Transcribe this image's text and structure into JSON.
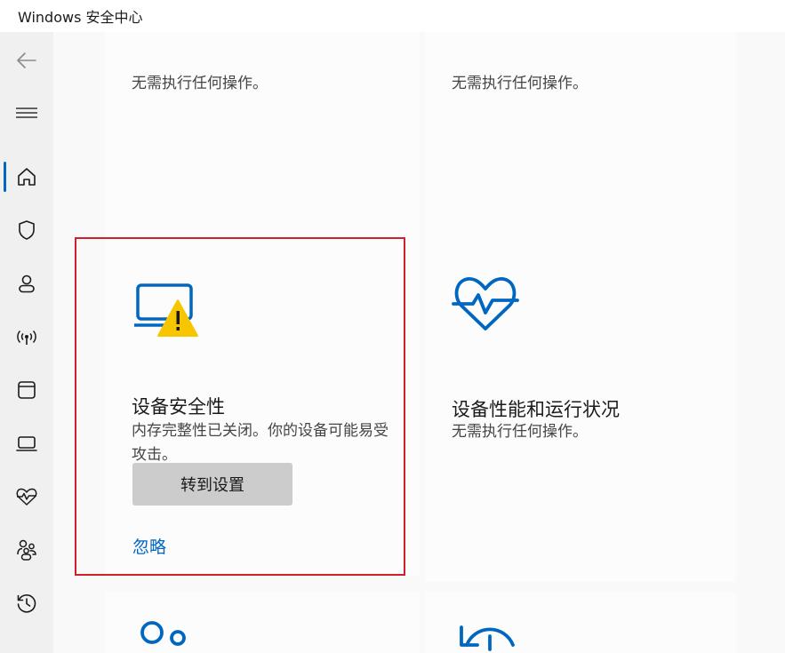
{
  "window": {
    "title": "Windows 安全中心"
  },
  "nav": {
    "items": [
      {
        "name": "back-arrow-icon"
      },
      {
        "name": "hamburger-menu-icon"
      },
      {
        "name": "home-icon"
      },
      {
        "name": "shield-icon"
      },
      {
        "name": "account-icon"
      },
      {
        "name": "wireless-icon"
      },
      {
        "name": "app-browser-icon"
      },
      {
        "name": "laptop-icon"
      },
      {
        "name": "heart-pulse-icon"
      },
      {
        "name": "family-icon"
      },
      {
        "name": "history-icon"
      }
    ],
    "active": "home"
  },
  "cards": {
    "virus": {
      "desc": "无需执行任何操作。"
    },
    "app_browser": {
      "desc": "无需执行任何操作。"
    },
    "device_security": {
      "title": "设备安全性",
      "desc": "内存完整性已关闭。你的设备可能易受攻击。",
      "button": "转到设置",
      "link": "忽略",
      "icon": "laptop-warning-icon"
    },
    "device_performance": {
      "title": "设备性能和运行状况",
      "desc": "无需执行任何操作。",
      "icon": "heart-pulse-icon"
    }
  },
  "colors": {
    "accent": "#0067c0",
    "warning": "#f7c600",
    "highlight_border": "#d1202d"
  }
}
